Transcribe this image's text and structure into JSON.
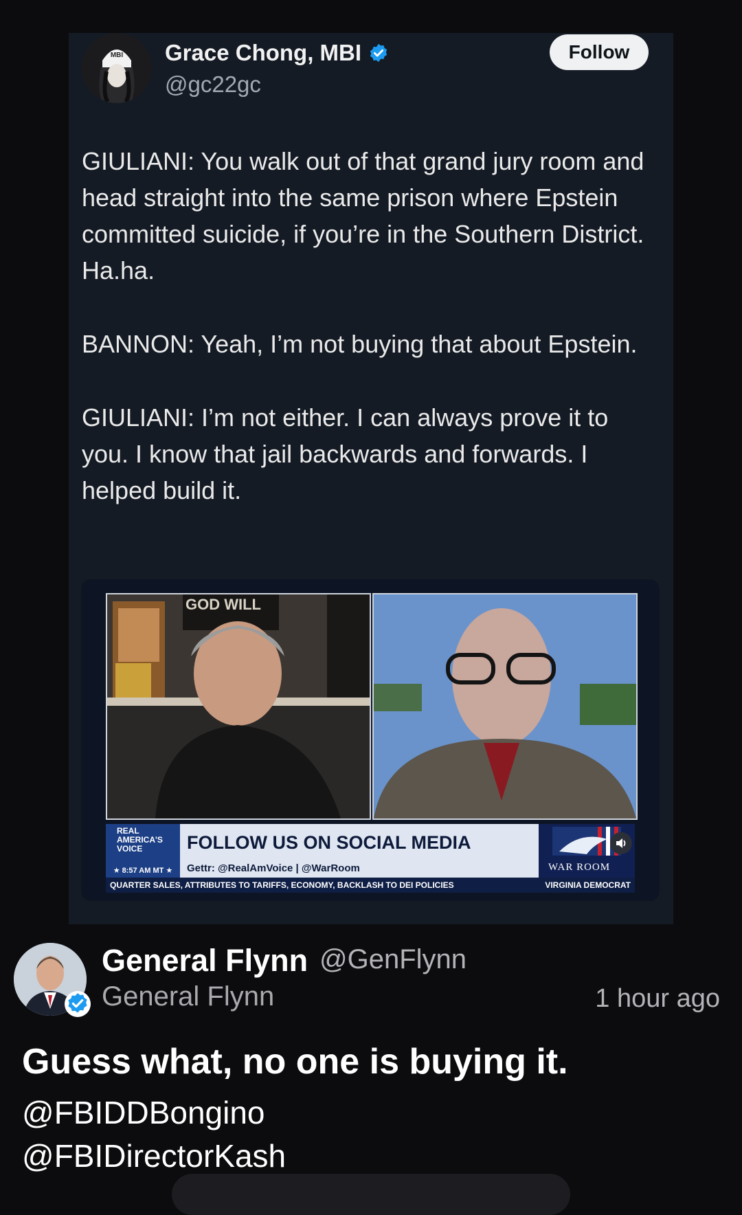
{
  "quoted_tweet": {
    "display_name": "Grace Chong, MBI",
    "handle": "@gc22gc",
    "follow_label": "Follow",
    "avatar_text": "MBI",
    "paragraphs": [
      "GIULIANI: You walk out of that grand jury room and head straight into the same prison where Epstein committed suicide, if you’re in the Southern District. Ha.ha.",
      "BANNON: Yeah, I’m not buying that about Epstein.",
      "GIULIANI: I’m not either. I can always prove it to you. I know that jail backwards and forwards. I helped build it."
    ],
    "video": {
      "left_sign": "GOD WILL",
      "brand": "REAL AMERICA'S VOICE",
      "headline": "FOLLOW US ON SOCIAL MEDIA",
      "socials": "Gettr: @RealAmVoice | @WarRoom",
      "time": "★ 8:57 AM MT ★",
      "warroom": "WAR ROOM",
      "ticker_left": "QUARTER SALES, ATTRIBUTES TO TARIFFS, ECONOMY, BACKLASH TO DEI POLICIES",
      "ticker_right": "VIRGINIA DEMOCRAT"
    }
  },
  "post": {
    "display_name": "General Flynn",
    "handle": "@GenFlynn",
    "sub_name": "General Flynn",
    "timestamp": "1 hour ago",
    "text": "Guess what, no one is buying it.",
    "mentions": [
      "@FBIDDBongino",
      "@FBIDirectorKash"
    ]
  },
  "colors": {
    "verified": "#1d9bf0",
    "background": "#0c0c0e",
    "embed_background": "#151b25"
  },
  "icons": [
    "verified-badge-icon",
    "sound-icon"
  ]
}
